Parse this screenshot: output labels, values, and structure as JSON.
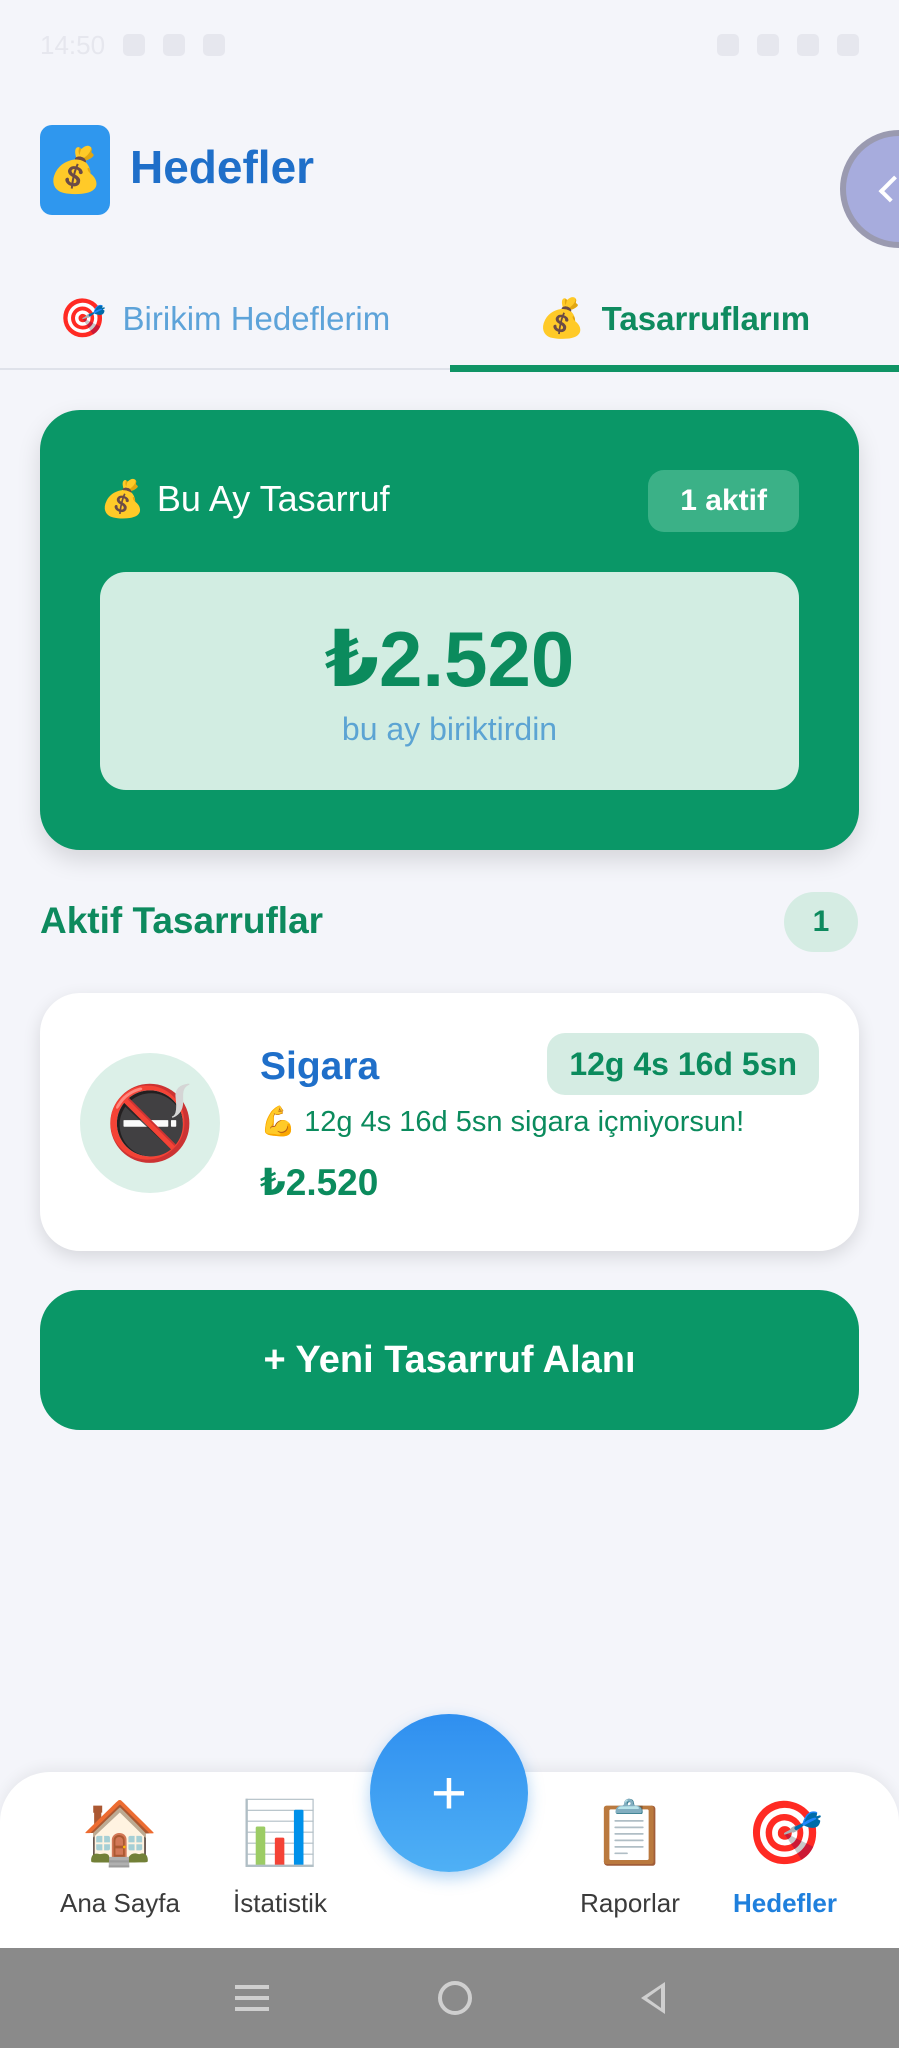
{
  "status_bar": {
    "time": "14:50"
  },
  "header": {
    "logo_icon": "money-bag-icon",
    "title": "Hedefler"
  },
  "tabs": [
    {
      "icon": "🎯",
      "label": "Birikim Hedeflerim",
      "active": false
    },
    {
      "icon": "💰",
      "label": "Tasarruflarım",
      "active": true
    }
  ],
  "summary": {
    "icon": "💰",
    "title": "Bu Ay Tasarruf",
    "badge": "1 aktif",
    "amount": "₺2.520",
    "subtitle": "bu ay biriktirdin"
  },
  "active_section": {
    "title": "Aktif Tasarruflar",
    "count": "1"
  },
  "items": [
    {
      "icon": "🚭",
      "name": "Sigara",
      "timer": "12g 4s 16d 5sn",
      "message": "💪 12g 4s 16d 5sn sigara içmiyorsun!",
      "amount": "₺2.520"
    }
  ],
  "new_button": {
    "label": "+ Yeni Tasarruf Alanı"
  },
  "bottom_nav": {
    "items": [
      {
        "icon": "🏠",
        "label": "Ana Sayfa"
      },
      {
        "icon": "📊",
        "label": "İstatistik"
      },
      {
        "icon": "📋",
        "label": "Raporlar"
      },
      {
        "icon": "🎯",
        "label": "Hedefler",
        "active": true
      }
    ],
    "fab_label": "+"
  },
  "colors": {
    "primary_green": "#0a9767",
    "accent_blue": "#1f6fc9",
    "fab_blue": "#2f8ff0",
    "background": "#f4f5fa"
  }
}
